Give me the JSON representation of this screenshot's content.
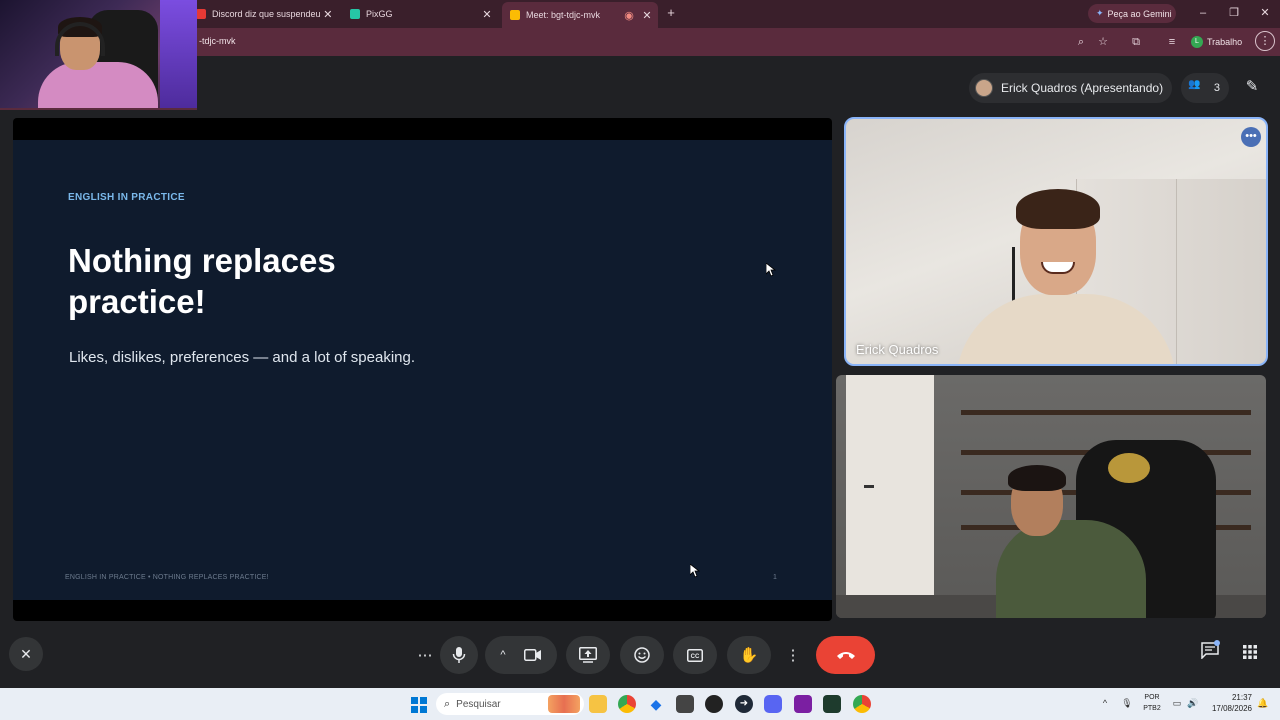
{
  "browser": {
    "tabs": [
      {
        "title": "Discord diz que suspendeu live",
        "favicon_color": "#e53935"
      },
      {
        "title": "PixGG",
        "favicon_color": "#26c6a6"
      },
      {
        "title": "Meet: bgt-tdjc-mvk",
        "favicon_color": "#fbbc04",
        "active": true
      }
    ],
    "new_tab": "+",
    "gemini_label": "Peça ao Gemini",
    "address": "-tdjc-mvk",
    "profile_label": "Trabalho",
    "profile_initial": "L",
    "accent": "#5a2b3d"
  },
  "meet": {
    "presenter_label": "Erick Quadros (Apresentando)",
    "participant_count": "3",
    "slide": {
      "kicker": "ENGLISH IN PRACTICE",
      "title": "Nothing replaces practice!",
      "subtitle": "Likes, dislikes, preferences — and a lot of speaking.",
      "footer": "ENGLISH IN PRACTICE  •  NOTHING REPLACES PRACTICE!",
      "page_number": "1"
    },
    "tiles": [
      {
        "name": "Erick Quadros"
      },
      {
        "name": ""
      }
    ],
    "controls": {
      "more_options": "more-horizontal-icon",
      "mic": "mic-icon",
      "camera": "camera-icon",
      "present": "present-screen-icon",
      "reactions": "emoji-icon",
      "captions": "captions-icon",
      "raise_hand": "hand-icon",
      "leave": "phone-hangup-icon"
    }
  },
  "taskbar": {
    "search_placeholder": "Pesquisar",
    "lang_line1": "POR",
    "lang_line2": "PTB2",
    "time": "21:37",
    "date": "17/08/2026"
  }
}
